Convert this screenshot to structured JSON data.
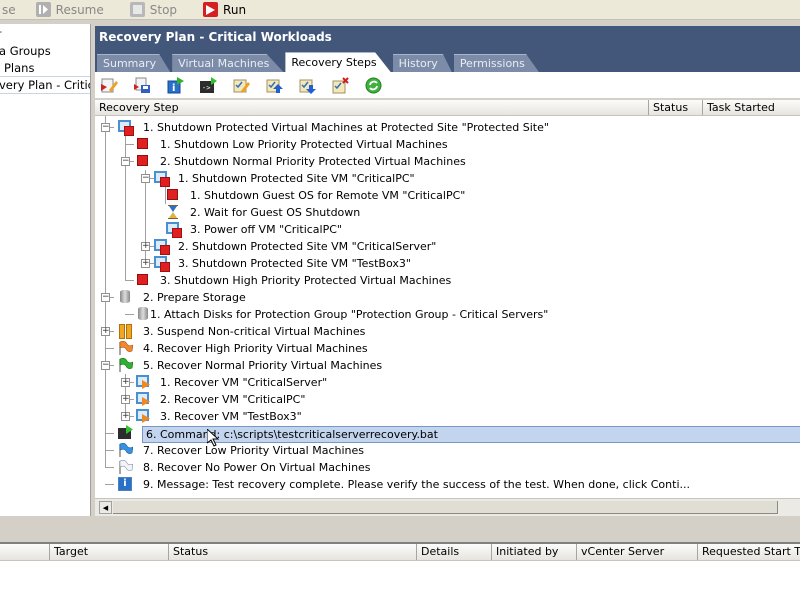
{
  "topbar": {
    "buttons": [
      {
        "label": "se",
        "icon": "pause-icon",
        "enabled": false
      },
      {
        "label": "Resume",
        "icon": "resume-icon",
        "enabled": false
      },
      {
        "label": "Stop",
        "icon": "stop-icon",
        "enabled": false
      },
      {
        "label": "Run",
        "icon": "run-icon",
        "enabled": true
      }
    ]
  },
  "left_panel": {
    "items": [
      {
        "label": "a Groups"
      },
      {
        "label": "Plans"
      },
      {
        "label": "very Plan - Critical W",
        "selected": true
      }
    ]
  },
  "header": {
    "title": "Recovery Plan - Critical Workloads"
  },
  "tabs": [
    {
      "label": "Summary",
      "active": false
    },
    {
      "label": "Virtual Machines",
      "active": false
    },
    {
      "label": "Recovery Steps",
      "active": true
    },
    {
      "label": "History",
      "active": false
    },
    {
      "label": "Permissions",
      "active": false
    }
  ],
  "toolbar_icons": [
    "edit-step-icon",
    "save-step-icon",
    "add-message-icon",
    "add-command-icon",
    "edit-item-icon",
    "move-up-icon",
    "move-down-icon",
    "delete-step-icon",
    "refresh-icon"
  ],
  "columns": [
    "Recovery Step",
    "Status",
    "Task Started"
  ],
  "steps": [
    {
      "label": "1. Shutdown Protected Virtual Machines at Protected Site \"Protected Site\"",
      "icon": "vm-shutdown",
      "level": 0,
      "expander": "minus"
    },
    {
      "label": "1. Shutdown Low Priority Protected Virtual Machines",
      "icon": "red-square",
      "level": 1,
      "expander": null
    },
    {
      "label": "2. Shutdown Normal Priority Protected Virtual Machines",
      "icon": "red-square",
      "level": 1,
      "expander": "minus"
    },
    {
      "label": "1. Shutdown Protected Site VM \"CriticalPC\"",
      "icon": "vm-shutdown",
      "level": 2,
      "expander": "minus"
    },
    {
      "label": "1. Shutdown Guest OS for Remote VM \"CriticalPC\"",
      "icon": "red-square",
      "level": 3,
      "expander": null
    },
    {
      "label": "2. Wait for Guest OS Shutdown",
      "icon": "hourglass",
      "level": 3,
      "expander": null
    },
    {
      "label": "3. Power off VM \"CriticalPC\"",
      "icon": "vm-shutdown",
      "level": 3,
      "expander": null
    },
    {
      "label": "2. Shutdown Protected Site VM \"CriticalServer\"",
      "icon": "vm-shutdown",
      "level": 2,
      "expander": "plus"
    },
    {
      "label": "3. Shutdown Protected Site VM \"TestBox3\"",
      "icon": "vm-shutdown",
      "level": 2,
      "expander": "plus"
    },
    {
      "label": "3. Shutdown High Priority Protected Virtual Machines",
      "icon": "red-square",
      "level": 1,
      "expander": null
    },
    {
      "label": "2. Prepare Storage",
      "icon": "disk",
      "level": 0,
      "expander": "minus"
    },
    {
      "label": "1. Attach Disks for Protection Group \"Protection Group - Critical Servers\"",
      "icon": "disk",
      "level": 1,
      "expander": null
    },
    {
      "label": "3. Suspend Non-critical Virtual Machines",
      "icon": "pause",
      "level": 0,
      "expander": "plus"
    },
    {
      "label": "4. Recover High Priority Virtual Machines",
      "icon": "flag-orange",
      "level": 0,
      "expander": null
    },
    {
      "label": "5. Recover Normal Priority Virtual Machines",
      "icon": "flag-green",
      "level": 0,
      "expander": "minus"
    },
    {
      "label": "1. Recover VM \"CriticalServer\"",
      "icon": "vm-recover",
      "level": 1,
      "expander": "plus"
    },
    {
      "label": "2. Recover VM \"CriticalPC\"",
      "icon": "vm-recover",
      "level": 1,
      "expander": "plus"
    },
    {
      "label": "3. Recover VM \"TestBox3\"",
      "icon": "vm-recover",
      "level": 1,
      "expander": "plus"
    },
    {
      "label": "6. Command: c:\\scripts\\testcriticalserverrecovery.bat",
      "icon": "command",
      "level": 0,
      "expander": null,
      "selected": true
    },
    {
      "label": "7. Recover Low Priority Virtual Machines",
      "icon": "flag-blue",
      "level": 0,
      "expander": null
    },
    {
      "label": "8. Recover No Power On Virtual Machines",
      "icon": "flag-white",
      "level": 0,
      "expander": null
    },
    {
      "label": "9. Message: Test recovery complete. Please verify the success of the test. When done, click Conti...",
      "icon": "info",
      "level": 0,
      "expander": null
    }
  ],
  "bottom_columns": [
    "",
    "Target",
    "Status",
    "Details",
    "Initiated by",
    "vCenter Server",
    "Requested Start Ti..."
  ],
  "colors": {
    "header_bg": "#42577a",
    "selection_bg": "#c2d4ee",
    "stop_red": "#e02020"
  }
}
